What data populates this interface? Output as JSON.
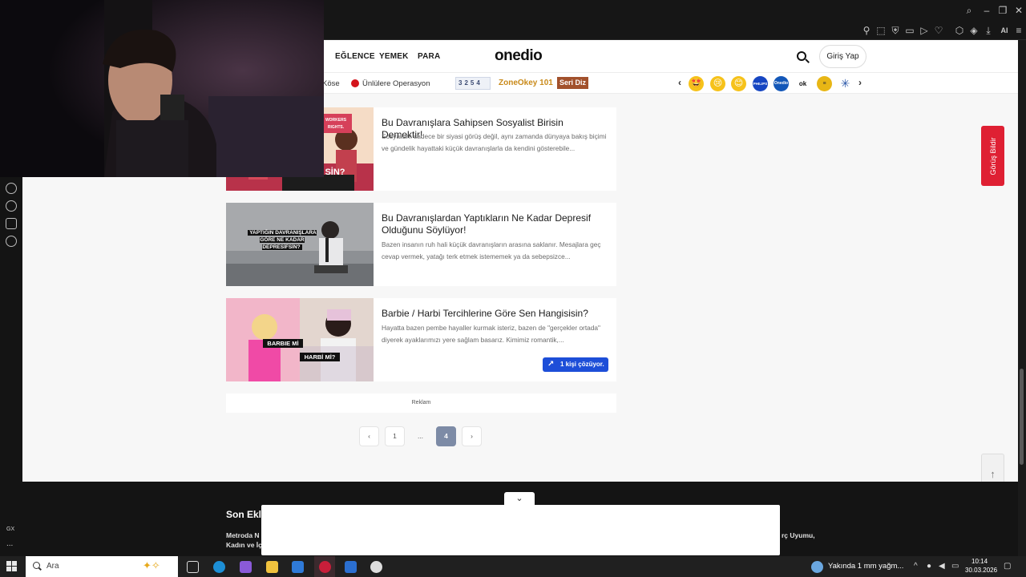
{
  "nav": {
    "links": [
      "EĞLENCE",
      "YEMEK",
      "PARA"
    ],
    "logo": "onedio",
    "login_label": "Giriş Yap"
  },
  "subnav": {
    "item_kose": "Köse",
    "item_unluler": "Ünlülere Operasyon",
    "zone_numbers": "3254",
    "zone_label": "ZoneOkey 101",
    "seri_diz": "Seri Diz",
    "emoji_labels": [
      "🤩",
      "😢",
      "😊",
      "PHILIPS",
      "Onedio",
      "ok",
      "≡",
      "✳"
    ]
  },
  "cards": [
    {
      "title": "Bu Davranışlara Sahipsen Sosyalist Birisin Demektir!",
      "desc": "Sosyalizm sadece bir siyasi görüş değil, aynı zamanda dünyaya bakış biçimi ve gündelik hayattaki küçük davranışlarla da kendini gösterebile...",
      "thumb_caption": "SİN?",
      "thumb_banner": "WORKERS RIGHTS."
    },
    {
      "title": "Bu Davranışlardan Yaptıkların Ne Kadar Depresif Olduğunu Söylüyor!",
      "desc": "Bazen insanın ruh hali küçük davranışların arasına saklanır. Mesajlara geç cevap vermek, yatağı terk etmek istememek ya da sebepsizce...",
      "thumb_caption": "YAPTIĞIN DAVRANIŞLARA GÖRE NE KADAR DEPRESİFSİN?"
    },
    {
      "title": "Barbie / Harbi Tercihlerine Göre Sen Hangisisin?",
      "desc": "Hayatta bazen pembe hayaller kurmak isteriz, bazen de \"gerçekler ortada\" diyerek ayaklarımızı yere sağlam basarız. Kimimiz romantik,...",
      "thumb_caption_1": "BARBIE Mİ",
      "thumb_caption_2": "HARBİ Mİ?",
      "solver_badge": "1 kişi çözüyor."
    }
  ],
  "reklam": "Reklam",
  "pagination": {
    "prev": "‹",
    "pages": [
      "1",
      "...",
      "4"
    ],
    "next": "›",
    "current": "4"
  },
  "feedback": "Görüş Bildir",
  "to_top": "↑",
  "footer": {
    "title": "Son Ekle",
    "line1": "Metroda N",
    "line2": "Kadın ve İç",
    "right1": "rç Uyumu,"
  },
  "taskbar": {
    "search_placeholder": "Ara",
    "weather": "Yakında 1 mm yağm...",
    "time": "10:14",
    "date": "30.03.2026"
  },
  "browser_side": {
    "gx_label": "GX",
    "more_label": "..."
  }
}
